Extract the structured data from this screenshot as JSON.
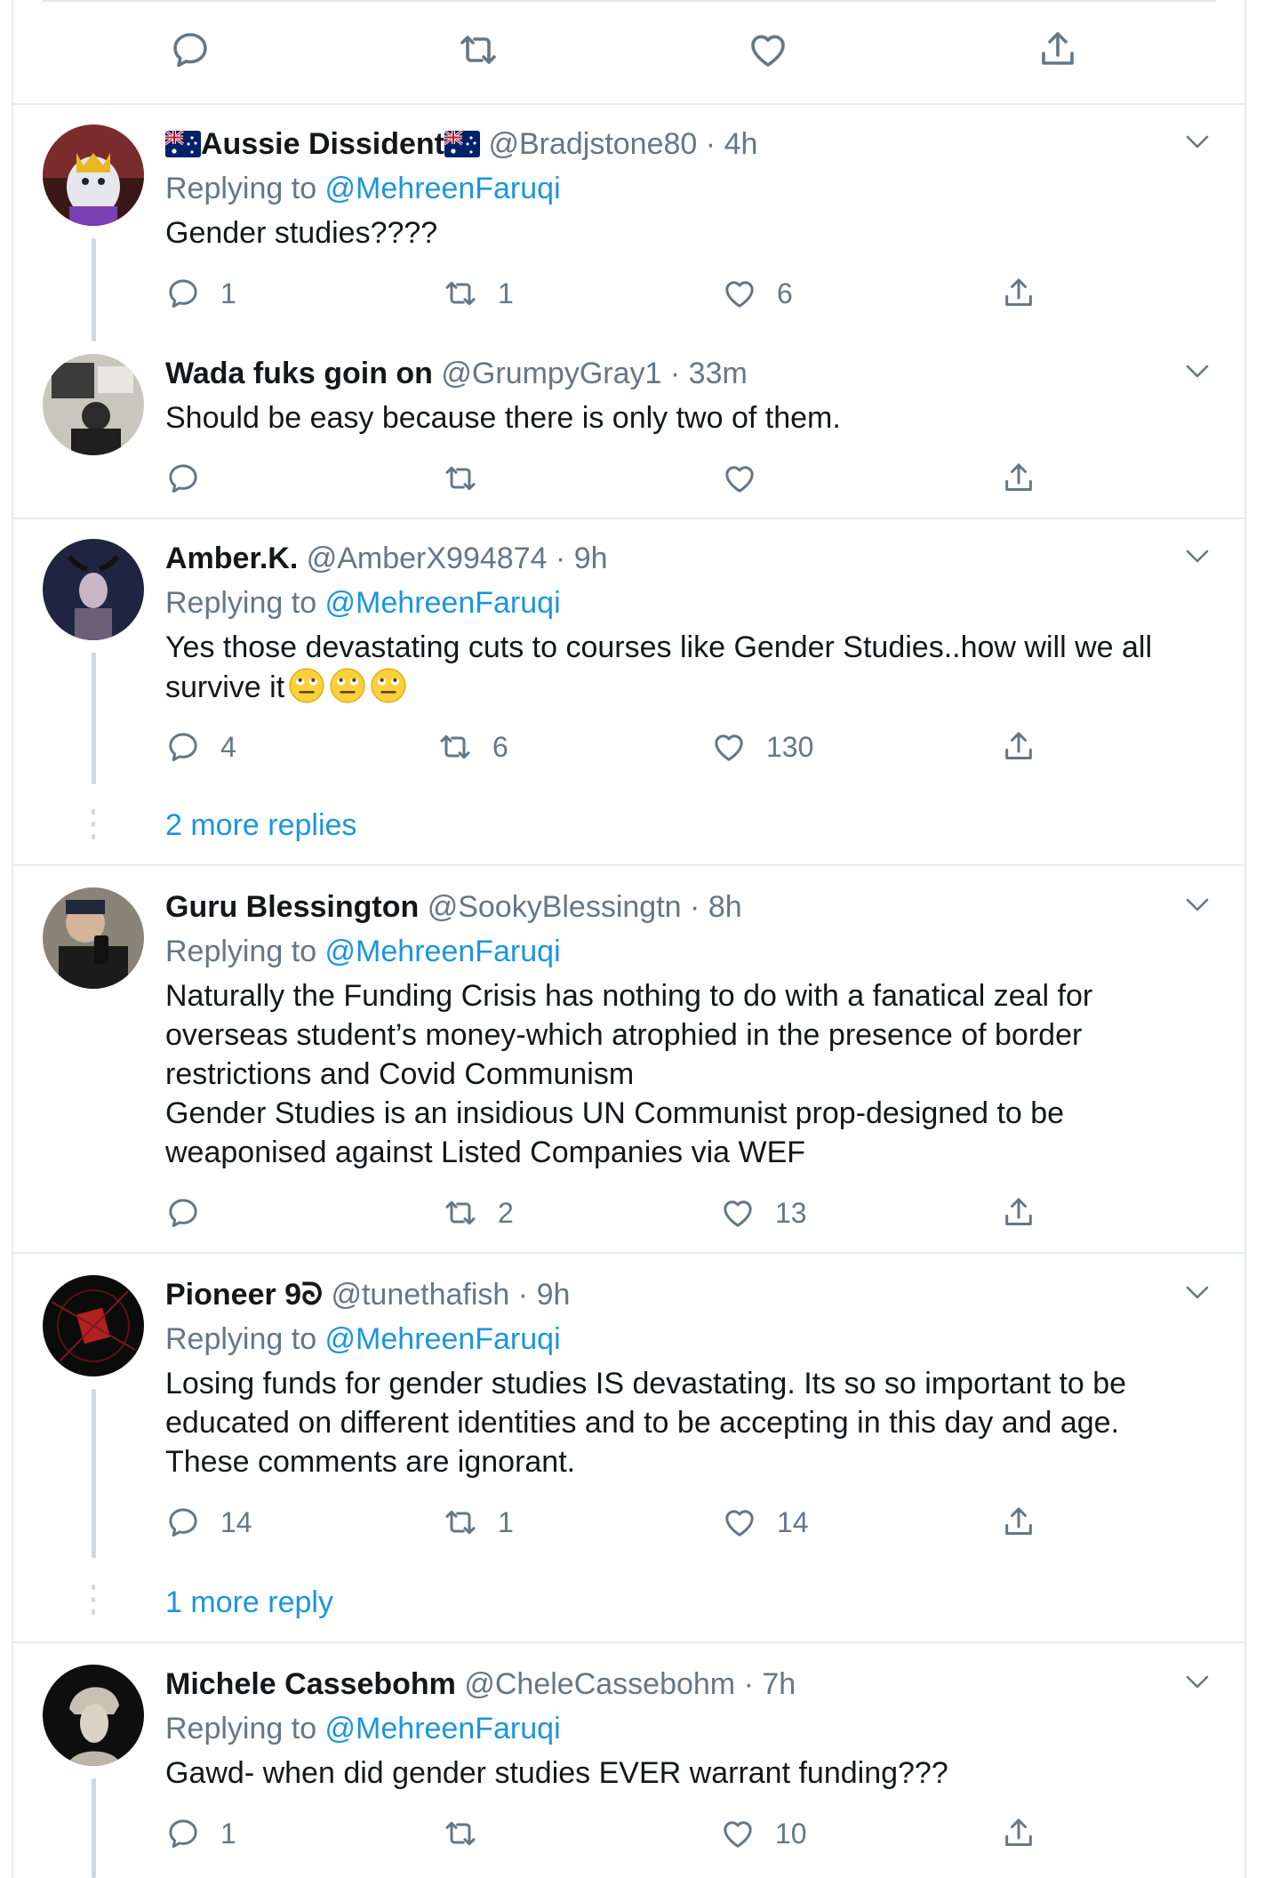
{
  "tweets": [
    {
      "name": "Aussie Dissident",
      "handle": "@Bradjstone80",
      "sep": "·",
      "time": "4h",
      "replying_prefix": "Replying to ",
      "replying_to": "@MehreenFaruqi",
      "text": [
        "Gender studies????"
      ],
      "replies": "1",
      "retweets": "1",
      "likes": "6"
    },
    {
      "name": "Wada fuks goin on",
      "handle": "@GrumpyGray1",
      "sep": "·",
      "time": "33m",
      "text": [
        "Should be easy because there is only two of them."
      ],
      "replies": "",
      "retweets": "",
      "likes": ""
    },
    {
      "name": "Amber.K.",
      "handle": "@AmberX994874",
      "sep": "·",
      "time": "9h",
      "replying_prefix": "Replying to ",
      "replying_to": "@MehreenFaruqi",
      "text": [
        "Yes those devastating cuts to courses like Gender Studies..how will we all",
        "survive it"
      ],
      "replies": "4",
      "retweets": "6",
      "likes": "130",
      "more_replies": "2 more replies"
    },
    {
      "name": "Guru Blessington",
      "handle": "@SookyBlessingtn",
      "sep": "·",
      "time": "8h",
      "replying_prefix": "Replying to ",
      "replying_to": "@MehreenFaruqi",
      "text": [
        "Naturally the Funding Crisis has nothing to do with a fanatical zeal for",
        "overseas student’s money-which atrophied in the presence of border",
        "restrictions and Covid Communism",
        "Gender Studies is an insidious UN Communist prop-designed to be",
        "weaponised against Listed Companies via WEF"
      ],
      "replies": "",
      "retweets": "2",
      "likes": "13"
    },
    {
      "name": "Pioneer 9ᘐ",
      "handle": "@tunethafish",
      "sep": "·",
      "time": "9h",
      "replying_prefix": "Replying to ",
      "replying_to": "@MehreenFaruqi",
      "text": [
        "Losing funds for gender studies IS devastating. Its so so important to be",
        "educated on different identities and to be accepting in this day and age.",
        "These comments are ignorant."
      ],
      "replies": "14",
      "retweets": "1",
      "likes": "14",
      "more_replies": "1 more reply"
    },
    {
      "name": "Michele Cassebohm",
      "handle": "@CheleCassebohm",
      "sep": "·",
      "time": "7h",
      "replying_prefix": "Replying to ",
      "replying_to": "@MehreenFaruqi",
      "text": [
        "Gawd- when did gender studies EVER warrant funding???"
      ],
      "replies": "1",
      "retweets": "",
      "likes": "10"
    }
  ],
  "colors": {
    "link": "#1b95e0",
    "secondary_text": "#657786",
    "border": "#e6ecf0",
    "thread_line": "#cfd9de"
  },
  "icons": [
    "reply-icon",
    "retweet-icon",
    "like-icon",
    "share-icon",
    "chevron-down-icon"
  ]
}
